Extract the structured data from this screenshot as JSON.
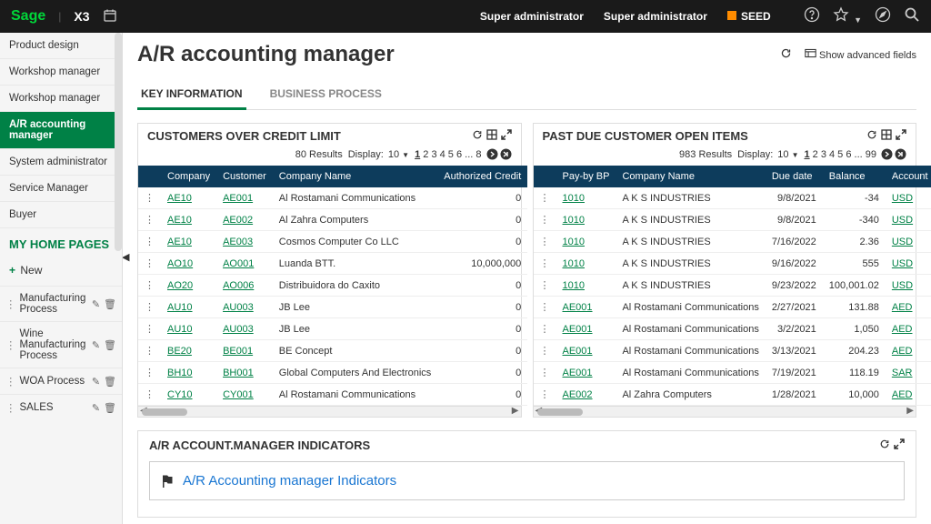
{
  "topbar": {
    "logo": "Sage",
    "product": "X3",
    "user1": "Super administrator",
    "user2": "Super administrator",
    "env": "SEED"
  },
  "sidebar": {
    "items": [
      "Product design",
      "Workshop manager",
      "Workshop manager",
      "A/R accounting manager",
      "System administrator",
      "Service Manager",
      "Buyer"
    ],
    "activeIndex": 3,
    "homeHeader": "MY HOME PAGES",
    "newLabel": "New",
    "pages": [
      "Manufacturing Process",
      "Wine Manufacturing Process",
      "WOA Process",
      "SALES"
    ]
  },
  "header": {
    "title": "A/R accounting manager",
    "advanced": "Show advanced fields"
  },
  "tabs": {
    "t1": "KEY INFORMATION",
    "t2": "BUSINESS PROCESS"
  },
  "panel1": {
    "title": "CUSTOMERS OVER CREDIT LIMIT",
    "results": "80 Results",
    "displayLabel": "Display:",
    "displayVal": "10",
    "pageText": "1 2 3 4 5 6 ... 8",
    "cols": [
      "Company",
      "Customer",
      "Company Name",
      "Authorized Credit"
    ],
    "rows": [
      {
        "c": "AE10",
        "u": "AE001",
        "n": "Al Rostamani Communications",
        "a": "0"
      },
      {
        "c": "AE10",
        "u": "AE002",
        "n": "Al Zahra Computers",
        "a": "0"
      },
      {
        "c": "AE10",
        "u": "AE003",
        "n": "Cosmos Computer Co LLC",
        "a": "0"
      },
      {
        "c": "AO10",
        "u": "AO001",
        "n": "Luanda BTT.",
        "a": "10,000,000"
      },
      {
        "c": "AO20",
        "u": "AO006",
        "n": "Distribuidora do Caxito",
        "a": "0"
      },
      {
        "c": "AU10",
        "u": "AU003",
        "n": "JB Lee",
        "a": "0"
      },
      {
        "c": "AU10",
        "u": "AU003",
        "n": "JB Lee",
        "a": "0"
      },
      {
        "c": "BE20",
        "u": "BE001",
        "n": "BE Concept",
        "a": "0"
      },
      {
        "c": "BH10",
        "u": "BH001",
        "n": "Global Computers And Electronics",
        "a": "0"
      },
      {
        "c": "CY10",
        "u": "CY001",
        "n": "Al Rostamani Communications",
        "a": "0"
      }
    ]
  },
  "panel2": {
    "title": "PAST DUE CUSTOMER OPEN ITEMS",
    "results": "983 Results",
    "displayLabel": "Display:",
    "displayVal": "10",
    "pageText": "1 2 3 4 5 6 ... 99",
    "cols": [
      "Pay-by BP",
      "Company Name",
      "Due date",
      "Balance",
      "Account"
    ],
    "rows": [
      {
        "bp": "1010",
        "n": "A K S INDUSTRIES",
        "d": "9/8/2021",
        "b": "-34",
        "cur": "USD"
      },
      {
        "bp": "1010",
        "n": "A K S INDUSTRIES",
        "d": "9/8/2021",
        "b": "-340",
        "cur": "USD"
      },
      {
        "bp": "1010",
        "n": "A K S INDUSTRIES",
        "d": "7/16/2022",
        "b": "2.36",
        "cur": "USD"
      },
      {
        "bp": "1010",
        "n": "A K S INDUSTRIES",
        "d": "9/16/2022",
        "b": "555",
        "cur": "USD"
      },
      {
        "bp": "1010",
        "n": "A K S INDUSTRIES",
        "d": "9/23/2022",
        "b": "100,001.02",
        "cur": "USD"
      },
      {
        "bp": "AE001",
        "n": "Al Rostamani Communications",
        "d": "2/27/2021",
        "b": "131.88",
        "cur": "AED"
      },
      {
        "bp": "AE001",
        "n": "Al Rostamani Communications",
        "d": "3/2/2021",
        "b": "1,050",
        "cur": "AED"
      },
      {
        "bp": "AE001",
        "n": "Al Rostamani Communications",
        "d": "3/13/2021",
        "b": "204.23",
        "cur": "AED"
      },
      {
        "bp": "AE001",
        "n": "Al Rostamani Communications",
        "d": "7/19/2021",
        "b": "118.19",
        "cur": "SAR"
      },
      {
        "bp": "AE002",
        "n": "Al Zahra Computers",
        "d": "1/28/2021",
        "b": "10,000",
        "cur": "AED"
      }
    ]
  },
  "indicators": {
    "panelTitle": "A/R ACCOUNT.MANAGER INDICATORS",
    "boxTitle": "A/R Accounting manager Indicators"
  }
}
